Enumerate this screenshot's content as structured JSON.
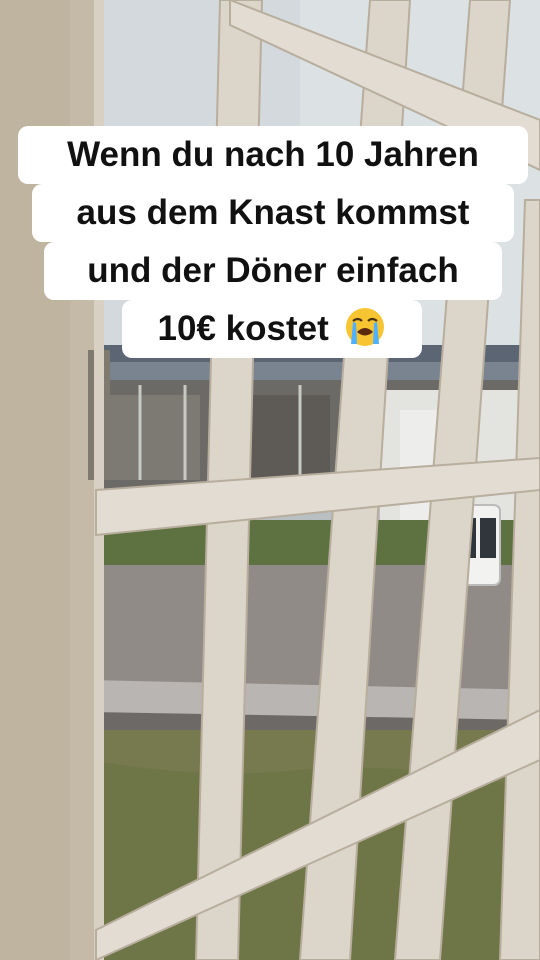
{
  "caption": {
    "line1": "Wenn du nach 10 Jahren",
    "line2": "aus dem Knast kommst",
    "line3": "und der Döner einfach",
    "line4": "10€ kostet",
    "emoji": "loudly-crying-face-icon"
  },
  "colors": {
    "sky": "#d4dadc",
    "bars": "#d9d2c6",
    "frame": "#cfc6b6",
    "grass": "#6f7a4a",
    "pavement": "#8f8a86",
    "building_roof": "#5a6472",
    "caption_bg": "#ffffff",
    "caption_text": "#111111"
  }
}
